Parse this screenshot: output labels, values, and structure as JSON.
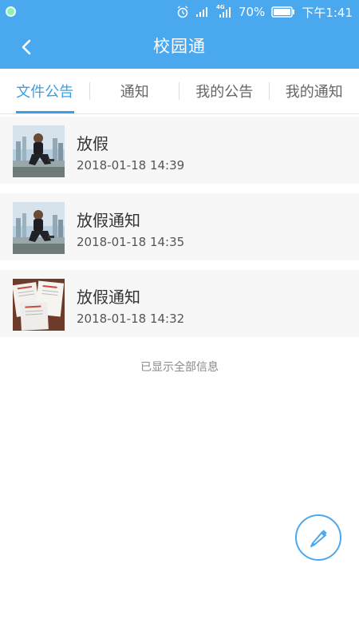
{
  "status_bar": {
    "battery_percent": "70%",
    "network_label": "4G",
    "time": "下午1:41"
  },
  "header": {
    "title": "校园通",
    "back_icon": "chevron-left-icon"
  },
  "tabs": [
    {
      "label": "文件公告",
      "active": true
    },
    {
      "label": "通知",
      "active": false
    },
    {
      "label": "我的公告",
      "active": false
    },
    {
      "label": "我的通知",
      "active": false
    }
  ],
  "items": [
    {
      "title": "放假",
      "time": "2018-01-18 14:39",
      "thumb": "photo-person"
    },
    {
      "title": "放假通知",
      "time": "2018-01-18 14:35",
      "thumb": "photo-person"
    },
    {
      "title": "放假通知",
      "time": "2018-01-18 14:32",
      "thumb": "photo-documents"
    }
  ],
  "footer_note": "已显示全部信息",
  "fab": {
    "icon": "pencil-icon"
  },
  "colors": {
    "primary": "#4aa8ef",
    "tab_active": "#3a9fe0",
    "item_bg": "#f7f7f7"
  }
}
